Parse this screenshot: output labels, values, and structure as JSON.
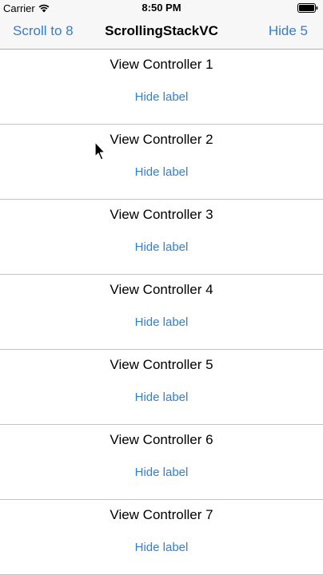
{
  "status_bar": {
    "carrier": "Carrier",
    "time": "8:50 PM",
    "wifi_icon": "wifi-icon",
    "battery_icon": "battery-icon"
  },
  "nav": {
    "left_button": "Scroll to 8",
    "title": "ScrollingStackVC",
    "right_button": "Hide 5"
  },
  "rows": [
    {
      "title": "View Controller 1",
      "action": "Hide label"
    },
    {
      "title": "View Controller 2",
      "action": "Hide label"
    },
    {
      "title": "View Controller 3",
      "action": "Hide label"
    },
    {
      "title": "View Controller 4",
      "action": "Hide label"
    },
    {
      "title": "View Controller 5",
      "action": "Hide label"
    },
    {
      "title": "View Controller 6",
      "action": "Hide label"
    },
    {
      "title": "View Controller 7",
      "action": "Hide label"
    }
  ],
  "colors": {
    "tint": "#2f80d1",
    "separator": "#c9c5b3",
    "bar_background": "#f7f7f7"
  }
}
